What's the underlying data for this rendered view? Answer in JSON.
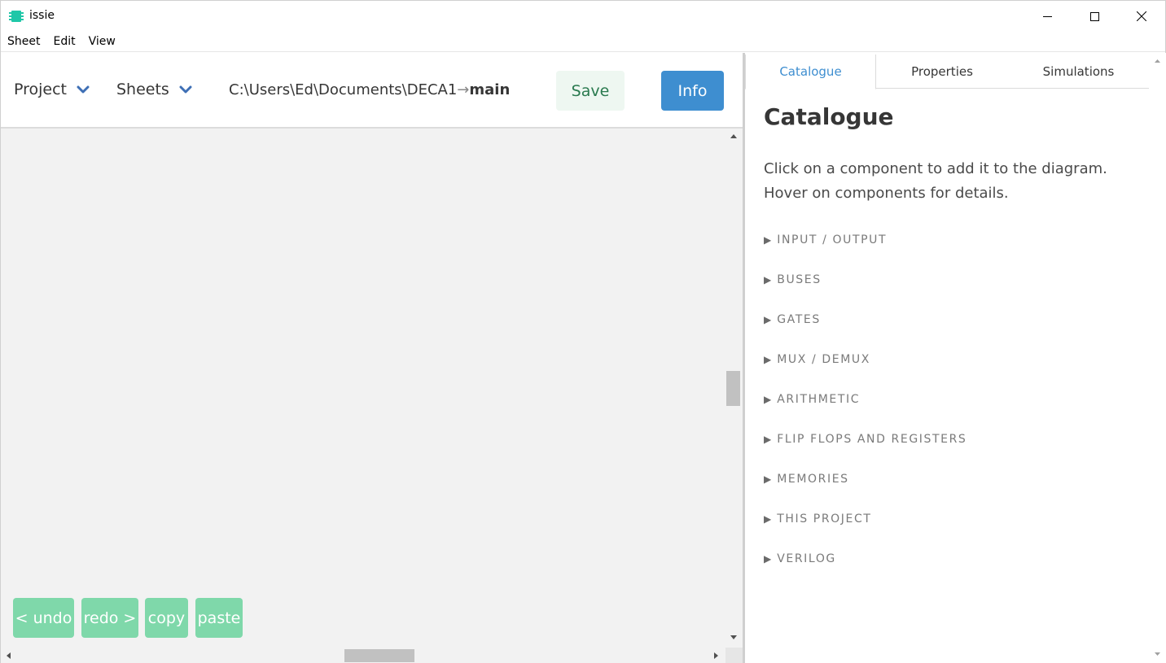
{
  "window": {
    "title": "issie",
    "controls": {
      "minimize": "minimize",
      "maximize": "maximize",
      "close": "close"
    }
  },
  "menubar": {
    "items": [
      "Sheet",
      "Edit",
      "View"
    ]
  },
  "toolbar": {
    "project_label": "Project",
    "sheets_label": "Sheets",
    "path_prefix": "C:\\Users\\Ed\\Documents\\DECA1",
    "path_arrow": "→",
    "path_sheet": "main",
    "save_label": "Save",
    "info_label": "Info"
  },
  "edit_buttons": {
    "undo": "< undo",
    "redo": "redo >",
    "copy": "copy",
    "paste": "paste"
  },
  "right_panel": {
    "tabs": [
      {
        "label": "Catalogue",
        "active": true
      },
      {
        "label": "Properties",
        "active": false
      },
      {
        "label": "Simulations",
        "active": false
      }
    ],
    "catalogue": {
      "title": "Catalogue",
      "description_line1": "Click on a component to add it to the diagram.",
      "description_line2": "Hover on components for details.",
      "sections": [
        "INPUT / OUTPUT",
        "BUSES",
        "GATES",
        "MUX / DEMUX",
        "ARITHMETIC",
        "FLIP FLOPS AND REGISTERS",
        "MEMORIES",
        "THIS PROJECT",
        "VERILOG"
      ]
    }
  },
  "colors": {
    "info_button": "#3e8ed0",
    "save_button_bg": "#eef7f1",
    "edit_button": "#7fd8aa",
    "active_tab": "#3e8ed0",
    "canvas": "#f2f2f2"
  }
}
